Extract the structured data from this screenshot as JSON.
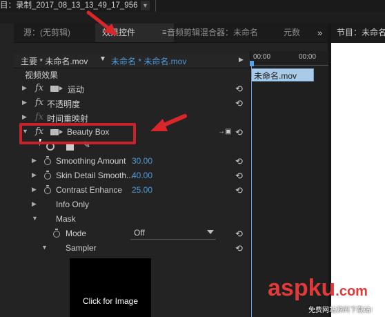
{
  "window": {
    "title": "目：录制_2017_08_13_13_49_17_956",
    "dropdown_icon": "chevron-down-icon"
  },
  "tabs": [
    {
      "label": "源：(无剪辑)",
      "active": false
    },
    {
      "label": "效果控件",
      "active": true
    },
    {
      "label": "音频剪辑混合器：未命名",
      "active": false
    },
    {
      "label": "元数",
      "active": false
    }
  ],
  "tab_menu_icon": "≡",
  "more_tabs_icon": "»",
  "program_monitor": {
    "title": "节目：未命名"
  },
  "effect_controls": {
    "master_label": "主要 * 未命名.mov",
    "clip_label": "未命名 * 未命名.mov",
    "section_label": "视频效果",
    "timeline": {
      "time_start": "00:00",
      "time_end": "00:00",
      "clip_name": "未命名.mov"
    },
    "effects": [
      {
        "label": "运动",
        "has_film_icon": true
      },
      {
        "label": "不透明度",
        "has_film_icon": false
      },
      {
        "label": "时间重映射",
        "has_film_icon": false,
        "dimmed": true
      },
      {
        "label": "Beauty Box",
        "has_film_icon": true,
        "expanded": true
      }
    ],
    "beauty_box_params": [
      {
        "label": "Smoothing Amount",
        "value": "30.00"
      },
      {
        "label": "Skin Detail Smooth...",
        "value": "40.00"
      },
      {
        "label": "Contrast Enhance",
        "value": "25.00"
      },
      {
        "label": "Info Only"
      },
      {
        "label": "Mask"
      },
      {
        "label": "Mode",
        "value": "Off"
      },
      {
        "label": "Sampler"
      }
    ],
    "preview_text": "Click for Image"
  },
  "watermark": {
    "main_a": "asp",
    "main_b": "ku",
    "main_c": ".com",
    "sub": "免费网站源码下载站!"
  },
  "colors": {
    "accent_blue": "#4f9ad9",
    "highlight_red": "#c8232a",
    "clip_bar": "#a9cbe8"
  }
}
